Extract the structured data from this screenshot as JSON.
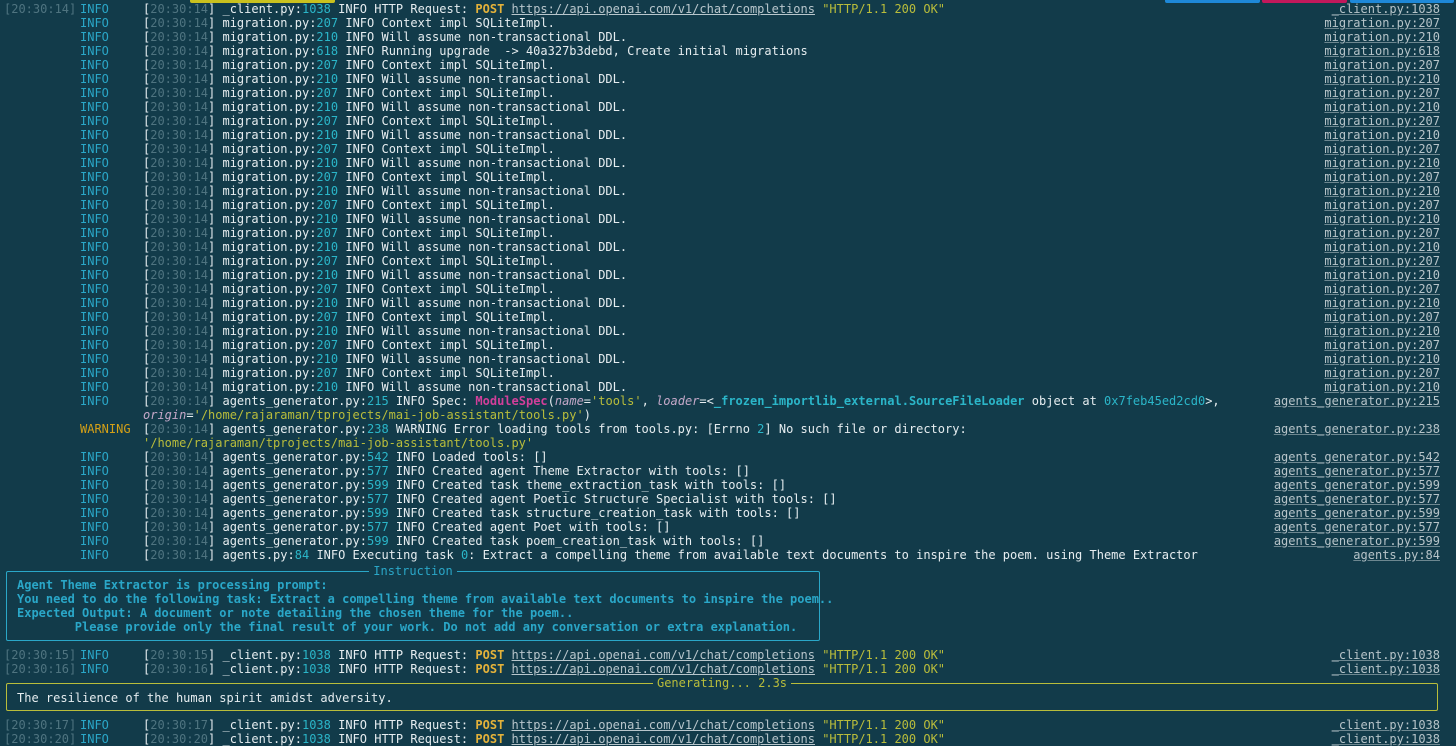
{
  "colors": {
    "background": "#123b4a",
    "info": "#2aa7c8",
    "warning": "#d4a017",
    "http_method": "#e4b23a",
    "string": "#b9bd3b",
    "class_name": "#d23f9a",
    "instruction_border": "#2aa7c8",
    "generating_border": "#b9bd3b"
  },
  "logs_top": [
    {
      "ts": "[20:30:14]",
      "level": "INFO",
      "mts": "20:30:14",
      "file": "_client.py",
      "line": "1038",
      "body": [
        [
          "INFO HTTP Request: ",
          ""
        ],
        [
          "POST",
          "post"
        ],
        [
          " ",
          ""
        ],
        [
          "https://api.openai.com/v1/chat/completions",
          "url"
        ],
        [
          " ",
          ""
        ],
        [
          "\"HTTP/1.1 200 OK\"",
          "okstr"
        ]
      ],
      "src": "_client.py:1038"
    },
    {
      "ts": "",
      "level": "INFO",
      "mts": "20:30:14",
      "file": "migration.py",
      "line": "207",
      "body": [
        [
          "INFO Context impl SQLiteImpl.",
          ""
        ]
      ],
      "src": "migration.py:207"
    },
    {
      "ts": "",
      "level": "INFO",
      "mts": "20:30:14",
      "file": "migration.py",
      "line": "210",
      "body": [
        [
          "INFO Will assume non-transactional DDL.",
          ""
        ]
      ],
      "src": "migration.py:210"
    },
    {
      "ts": "",
      "level": "INFO",
      "mts": "20:30:14",
      "file": "migration.py",
      "line": "618",
      "body": [
        [
          "INFO Running upgrade  -> 40a327b3debd, Create initial migrations",
          ""
        ]
      ],
      "src": "migration.py:618"
    },
    {
      "ts": "",
      "level": "INFO",
      "mts": "20:30:14",
      "file": "migration.py",
      "line": "207",
      "body": [
        [
          "INFO Context impl SQLiteImpl.",
          ""
        ]
      ],
      "src": "migration.py:207"
    },
    {
      "ts": "",
      "level": "INFO",
      "mts": "20:30:14",
      "file": "migration.py",
      "line": "210",
      "body": [
        [
          "INFO Will assume non-transactional DDL.",
          ""
        ]
      ],
      "src": "migration.py:210"
    },
    {
      "ts": "",
      "level": "INFO",
      "mts": "20:30:14",
      "file": "migration.py",
      "line": "207",
      "body": [
        [
          "INFO Context impl SQLiteImpl.",
          ""
        ]
      ],
      "src": "migration.py:207"
    },
    {
      "ts": "",
      "level": "INFO",
      "mts": "20:30:14",
      "file": "migration.py",
      "line": "210",
      "body": [
        [
          "INFO Will assume non-transactional DDL.",
          ""
        ]
      ],
      "src": "migration.py:210"
    },
    {
      "ts": "",
      "level": "INFO",
      "mts": "20:30:14",
      "file": "migration.py",
      "line": "207",
      "body": [
        [
          "INFO Context impl SQLiteImpl.",
          ""
        ]
      ],
      "src": "migration.py:207"
    },
    {
      "ts": "",
      "level": "INFO",
      "mts": "20:30:14",
      "file": "migration.py",
      "line": "210",
      "body": [
        [
          "INFO Will assume non-transactional DDL.",
          ""
        ]
      ],
      "src": "migration.py:210"
    },
    {
      "ts": "",
      "level": "INFO",
      "mts": "20:30:14",
      "file": "migration.py",
      "line": "207",
      "body": [
        [
          "INFO Context impl SQLiteImpl.",
          ""
        ]
      ],
      "src": "migration.py:207"
    },
    {
      "ts": "",
      "level": "INFO",
      "mts": "20:30:14",
      "file": "migration.py",
      "line": "210",
      "body": [
        [
          "INFO Will assume non-transactional DDL.",
          ""
        ]
      ],
      "src": "migration.py:210"
    },
    {
      "ts": "",
      "level": "INFO",
      "mts": "20:30:14",
      "file": "migration.py",
      "line": "207",
      "body": [
        [
          "INFO Context impl SQLiteImpl.",
          ""
        ]
      ],
      "src": "migration.py:207"
    },
    {
      "ts": "",
      "level": "INFO",
      "mts": "20:30:14",
      "file": "migration.py",
      "line": "210",
      "body": [
        [
          "INFO Will assume non-transactional DDL.",
          ""
        ]
      ],
      "src": "migration.py:210"
    },
    {
      "ts": "",
      "level": "INFO",
      "mts": "20:30:14",
      "file": "migration.py",
      "line": "207",
      "body": [
        [
          "INFO Context impl SQLiteImpl.",
          ""
        ]
      ],
      "src": "migration.py:207"
    },
    {
      "ts": "",
      "level": "INFO",
      "mts": "20:30:14",
      "file": "migration.py",
      "line": "210",
      "body": [
        [
          "INFO Will assume non-transactional DDL.",
          ""
        ]
      ],
      "src": "migration.py:210"
    },
    {
      "ts": "",
      "level": "INFO",
      "mts": "20:30:14",
      "file": "migration.py",
      "line": "207",
      "body": [
        [
          "INFO Context impl SQLiteImpl.",
          ""
        ]
      ],
      "src": "migration.py:207"
    },
    {
      "ts": "",
      "level": "INFO",
      "mts": "20:30:14",
      "file": "migration.py",
      "line": "210",
      "body": [
        [
          "INFO Will assume non-transactional DDL.",
          ""
        ]
      ],
      "src": "migration.py:210"
    },
    {
      "ts": "",
      "level": "INFO",
      "mts": "20:30:14",
      "file": "migration.py",
      "line": "207",
      "body": [
        [
          "INFO Context impl SQLiteImpl.",
          ""
        ]
      ],
      "src": "migration.py:207"
    },
    {
      "ts": "",
      "level": "INFO",
      "mts": "20:30:14",
      "file": "migration.py",
      "line": "210",
      "body": [
        [
          "INFO Will assume non-transactional DDL.",
          ""
        ]
      ],
      "src": "migration.py:210"
    },
    {
      "ts": "",
      "level": "INFO",
      "mts": "20:30:14",
      "file": "migration.py",
      "line": "207",
      "body": [
        [
          "INFO Context impl SQLiteImpl.",
          ""
        ]
      ],
      "src": "migration.py:207"
    },
    {
      "ts": "",
      "level": "INFO",
      "mts": "20:30:14",
      "file": "migration.py",
      "line": "210",
      "body": [
        [
          "INFO Will assume non-transactional DDL.",
          ""
        ]
      ],
      "src": "migration.py:210"
    },
    {
      "ts": "",
      "level": "INFO",
      "mts": "20:30:14",
      "file": "migration.py",
      "line": "207",
      "body": [
        [
          "INFO Context impl SQLiteImpl.",
          ""
        ]
      ],
      "src": "migration.py:207"
    },
    {
      "ts": "",
      "level": "INFO",
      "mts": "20:30:14",
      "file": "migration.py",
      "line": "210",
      "body": [
        [
          "INFO Will assume non-transactional DDL.",
          ""
        ]
      ],
      "src": "migration.py:210"
    },
    {
      "ts": "",
      "level": "INFO",
      "mts": "20:30:14",
      "file": "migration.py",
      "line": "207",
      "body": [
        [
          "INFO Context impl SQLiteImpl.",
          ""
        ]
      ],
      "src": "migration.py:207"
    },
    {
      "ts": "",
      "level": "INFO",
      "mts": "20:30:14",
      "file": "migration.py",
      "line": "210",
      "body": [
        [
          "INFO Will assume non-transactional DDL.",
          ""
        ]
      ],
      "src": "migration.py:210"
    },
    {
      "ts": "",
      "level": "INFO",
      "mts": "20:30:14",
      "file": "migration.py",
      "line": "207",
      "body": [
        [
          "INFO Context impl SQLiteImpl.",
          ""
        ]
      ],
      "src": "migration.py:207"
    },
    {
      "ts": "",
      "level": "INFO",
      "mts": "20:30:14",
      "file": "migration.py",
      "line": "210",
      "body": [
        [
          "INFO Will assume non-transactional DDL.",
          ""
        ]
      ],
      "src": "migration.py:210"
    },
    {
      "ts": "",
      "level": "INFO",
      "mts": "20:30:14",
      "file": "agents_generator.py",
      "line": "215",
      "body": [
        [
          "INFO Spec: ",
          ""
        ],
        [
          "ModuleSpec",
          "cls"
        ],
        [
          "(",
          ""
        ],
        [
          "name",
          "kw"
        ],
        [
          "=",
          ""
        ],
        [
          "'tools'",
          "str"
        ],
        [
          ", ",
          ""
        ],
        [
          "loader",
          "kw"
        ],
        [
          "=<",
          ""
        ],
        [
          "_frozen_importlib_external.SourceFileLoader",
          "ldr"
        ],
        [
          " object at ",
          ""
        ],
        [
          "0x7feb45ed2cd0",
          "hex"
        ],
        [
          ">,",
          ""
        ]
      ],
      "src": "agents_generator.py:215"
    },
    {
      "ts": "",
      "level": "",
      "mts": "",
      "file": "",
      "line": "",
      "body": [
        [
          "origin",
          "kw"
        ],
        [
          "=",
          ""
        ],
        [
          "'/home/rajaraman/tprojects/mai-job-assistant/tools.py'",
          "str"
        ],
        [
          ")",
          ""
        ]
      ],
      "src": ""
    },
    {
      "ts": "",
      "level": "WARNING",
      "mts": "20:30:14",
      "file": "agents_generator.py",
      "line": "238",
      "body": [
        [
          "WARNING Error loading tools from tools.py: [Errno ",
          ""
        ],
        [
          "2",
          "num"
        ],
        [
          "] No such file or directory:",
          ""
        ]
      ],
      "src": "agents_generator.py:238"
    },
    {
      "ts": "",
      "level": "",
      "mts": "",
      "file": "",
      "line": "",
      "body": [
        [
          "'/home/rajaraman/tprojects/mai-job-assistant/tools.py'",
          "str"
        ]
      ],
      "src": ""
    },
    {
      "ts": "",
      "level": "INFO",
      "mts": "20:30:14",
      "file": "agents_generator.py",
      "line": "542",
      "body": [
        [
          "INFO Loaded tools: []",
          ""
        ]
      ],
      "src": "agents_generator.py:542"
    },
    {
      "ts": "",
      "level": "INFO",
      "mts": "20:30:14",
      "file": "agents_generator.py",
      "line": "577",
      "body": [
        [
          "INFO Created agent Theme Extractor with tools: []",
          ""
        ]
      ],
      "src": "agents_generator.py:577"
    },
    {
      "ts": "",
      "level": "INFO",
      "mts": "20:30:14",
      "file": "agents_generator.py",
      "line": "599",
      "body": [
        [
          "INFO Created task theme_extraction_task with tools: []",
          ""
        ]
      ],
      "src": "agents_generator.py:599"
    },
    {
      "ts": "",
      "level": "INFO",
      "mts": "20:30:14",
      "file": "agents_generator.py",
      "line": "577",
      "body": [
        [
          "INFO Created agent Poetic Structure Specialist with tools: []",
          ""
        ]
      ],
      "src": "agents_generator.py:577"
    },
    {
      "ts": "",
      "level": "INFO",
      "mts": "20:30:14",
      "file": "agents_generator.py",
      "line": "599",
      "body": [
        [
          "INFO Created task structure_creation_task with tools: []",
          ""
        ]
      ],
      "src": "agents_generator.py:599"
    },
    {
      "ts": "",
      "level": "INFO",
      "mts": "20:30:14",
      "file": "agents_generator.py",
      "line": "577",
      "body": [
        [
          "INFO Created agent Poet with tools: []",
          ""
        ]
      ],
      "src": "agents_generator.py:577"
    },
    {
      "ts": "",
      "level": "INFO",
      "mts": "20:30:14",
      "file": "agents_generator.py",
      "line": "599",
      "body": [
        [
          "INFO Created task poem_creation_task with tools: []",
          ""
        ]
      ],
      "src": "agents_generator.py:599"
    },
    {
      "ts": "",
      "level": "INFO",
      "mts": "20:30:14",
      "file": "agents.py",
      "line": "84",
      "body": [
        [
          "INFO Executing task ",
          ""
        ],
        [
          "0",
          "num"
        ],
        [
          ": Extract a compelling theme from available text documents to inspire the poem. using Theme Extractor",
          ""
        ]
      ],
      "src": "agents.py:84"
    }
  ],
  "instruction": {
    "title": "Instruction",
    "lines": [
      "Agent Theme Extractor is processing prompt:",
      "You need to do the following task: Extract a compelling theme from available text documents to inspire the poem..",
      "Expected Output: A document or note detailing the chosen theme for the poem..",
      "        Please provide only the final result of your work. Do not add any conversation or extra explanation."
    ]
  },
  "logs_mid": [
    {
      "ts": "[20:30:15]",
      "level": "INFO",
      "mts": "20:30:15",
      "file": "_client.py",
      "line": "1038",
      "body": [
        [
          "INFO HTTP Request: ",
          ""
        ],
        [
          "POST",
          "post"
        ],
        [
          " ",
          ""
        ],
        [
          "https://api.openai.com/v1/chat/completions",
          "url"
        ],
        [
          " ",
          ""
        ],
        [
          "\"HTTP/1.1 200 OK\"",
          "okstr"
        ]
      ],
      "src": "_client.py:1038"
    },
    {
      "ts": "[20:30:16]",
      "level": "INFO",
      "mts": "20:30:16",
      "file": "_client.py",
      "line": "1038",
      "body": [
        [
          "INFO HTTP Request: ",
          ""
        ],
        [
          "POST",
          "post"
        ],
        [
          " ",
          ""
        ],
        [
          "https://api.openai.com/v1/chat/completions",
          "url"
        ],
        [
          " ",
          ""
        ],
        [
          "\"HTTP/1.1 200 OK\"",
          "okstr"
        ]
      ],
      "src": "_client.py:1038"
    }
  ],
  "generating": {
    "title": "Generating... 2.3s",
    "text": "The resilience of the human spirit amidst adversity."
  },
  "logs_bottom": [
    {
      "ts": "[20:30:17]",
      "level": "INFO",
      "mts": "20:30:17",
      "file": "_client.py",
      "line": "1038",
      "body": [
        [
          "INFO HTTP Request: ",
          ""
        ],
        [
          "POST",
          "post"
        ],
        [
          " ",
          ""
        ],
        [
          "https://api.openai.com/v1/chat/completions",
          "url"
        ],
        [
          " ",
          ""
        ],
        [
          "\"HTTP/1.1 200 OK\"",
          "okstr"
        ]
      ],
      "src": "_client.py:1038"
    },
    {
      "ts": "[20:30:20]",
      "level": "INFO",
      "mts": "20:30:20",
      "file": "_client.py",
      "line": "1038",
      "body": [
        [
          "INFO HTTP Request: ",
          ""
        ],
        [
          "POST",
          "post"
        ],
        [
          " ",
          ""
        ],
        [
          "https://api.openai.com/v1/chat/completions",
          "url"
        ],
        [
          " ",
          ""
        ],
        [
          "\"HTTP/1.1 200 OK\"",
          "okstr"
        ]
      ],
      "src": "_client.py:1038"
    }
  ]
}
